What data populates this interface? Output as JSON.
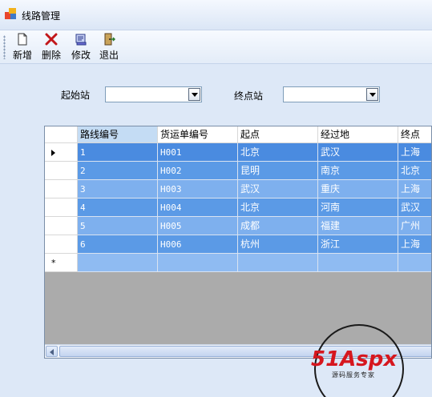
{
  "window": {
    "title": "线路管理"
  },
  "toolbar": {
    "buttons": [
      {
        "label": "新增",
        "icon": "new-file-icon"
      },
      {
        "label": "删除",
        "icon": "delete-x-icon"
      },
      {
        "label": "修改",
        "icon": "edit-icon"
      },
      {
        "label": "退出",
        "icon": "exit-door-icon"
      }
    ]
  },
  "filters": {
    "start_label": "起始站",
    "start_value": "",
    "end_label": "终点站",
    "end_value": ""
  },
  "grid": {
    "columns": [
      "路线编号",
      "货运单编号",
      "起点",
      "经过地",
      "终点"
    ],
    "rows": [
      [
        "1",
        "H001",
        "北京",
        "武汉",
        "上海"
      ],
      [
        "2",
        "H002",
        "昆明",
        "南京",
        "北京"
      ],
      [
        "3",
        "H003",
        "武汉",
        "重庆",
        "上海"
      ],
      [
        "4",
        "H004",
        "北京",
        "河南",
        "武汉"
      ],
      [
        "5",
        "H005",
        "成都",
        "福建",
        "广州"
      ],
      [
        "6",
        "H006",
        "杭州",
        "浙江",
        "上海"
      ]
    ],
    "new_row_marker": "*"
  },
  "watermark": {
    "brand": "51Aspx",
    "slogan": "源码服务专家"
  },
  "colors": {
    "selected_row": "#4a8be0",
    "row_dark": "#5b9ae6",
    "row_light": "#7eb0ee",
    "window_bg": "#dde8f7"
  }
}
